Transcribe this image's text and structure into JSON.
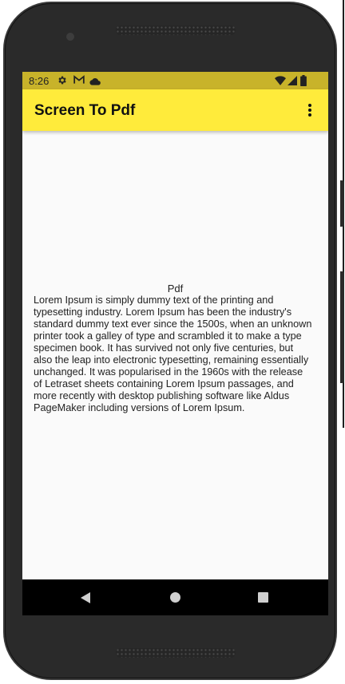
{
  "status_bar": {
    "time": "8:26",
    "left_icons": [
      "settings-icon",
      "gmail-icon",
      "cloud-icon"
    ],
    "right_icons": [
      "wifi-icon",
      "signal-icon",
      "battery-icon"
    ]
  },
  "app_bar": {
    "title": "Screen To Pdf",
    "menu_icon": "more-vert-icon"
  },
  "content": {
    "label": "Pdf",
    "body": "Lorem Ipsum is simply dummy text of the printing and typesetting industry. Lorem Ipsum has been the industry's standard dummy text ever since the 1500s, when an unknown printer took a galley of type and scrambled it to make a type specimen book. It has survived not only five centuries, but also the leap into electronic typesetting, remaining essentially unchanged. It was popularised in the 1960s with the release of Letraset sheets containing Lorem Ipsum passages, and more recently with desktop publishing software like Aldus PageMaker including versions of Lorem Ipsum."
  },
  "nav_bar": {
    "buttons": [
      "back-icon",
      "home-icon",
      "recents-icon"
    ]
  },
  "colors": {
    "status_bar": "#c8b32a",
    "app_bar": "#ffeb3b",
    "background": "#fafafa",
    "nav_bar": "#000000"
  }
}
